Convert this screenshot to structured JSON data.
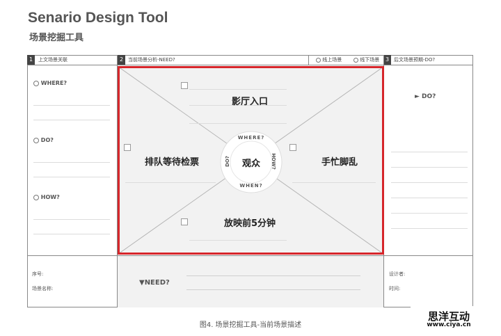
{
  "title": "Senario Design Tool",
  "subtitle": "场景挖掘工具",
  "header": {
    "col1_num": "1",
    "col1_label": "上文场景关联",
    "col2_num": "2",
    "col2_label": "当前场景分析-NEED?",
    "online": "线上场景",
    "offline": "线下场景",
    "col3_num": "3",
    "col3_label": "后文场景预期-DO?"
  },
  "left": {
    "where": "WHERE?",
    "do": "DO?",
    "how": "HOW?"
  },
  "center": {
    "top": "影厅入口",
    "left": "排队等待检票",
    "right": "手忙脚乱",
    "bottom": "放映前5分钟",
    "core": "观众",
    "ring_top": "WHERE?",
    "ring_right": "HOW?",
    "ring_bottom": "WHEN?",
    "ring_left": "DO?"
  },
  "right": {
    "do": "► DO?"
  },
  "footer": {
    "seq": "序号:",
    "scene_name": "场景名称:",
    "need": "▼NEED?",
    "designer": "设计者:",
    "time": "时间:"
  },
  "caption": "图4. 场景挖掘工具-当前场景描述",
  "watermark": {
    "brand": "思洋互动",
    "url": "www.ciya.cn"
  },
  "colors": {
    "accent": "#d6262b",
    "panel": "#f2f2f2",
    "line": "#888888"
  }
}
